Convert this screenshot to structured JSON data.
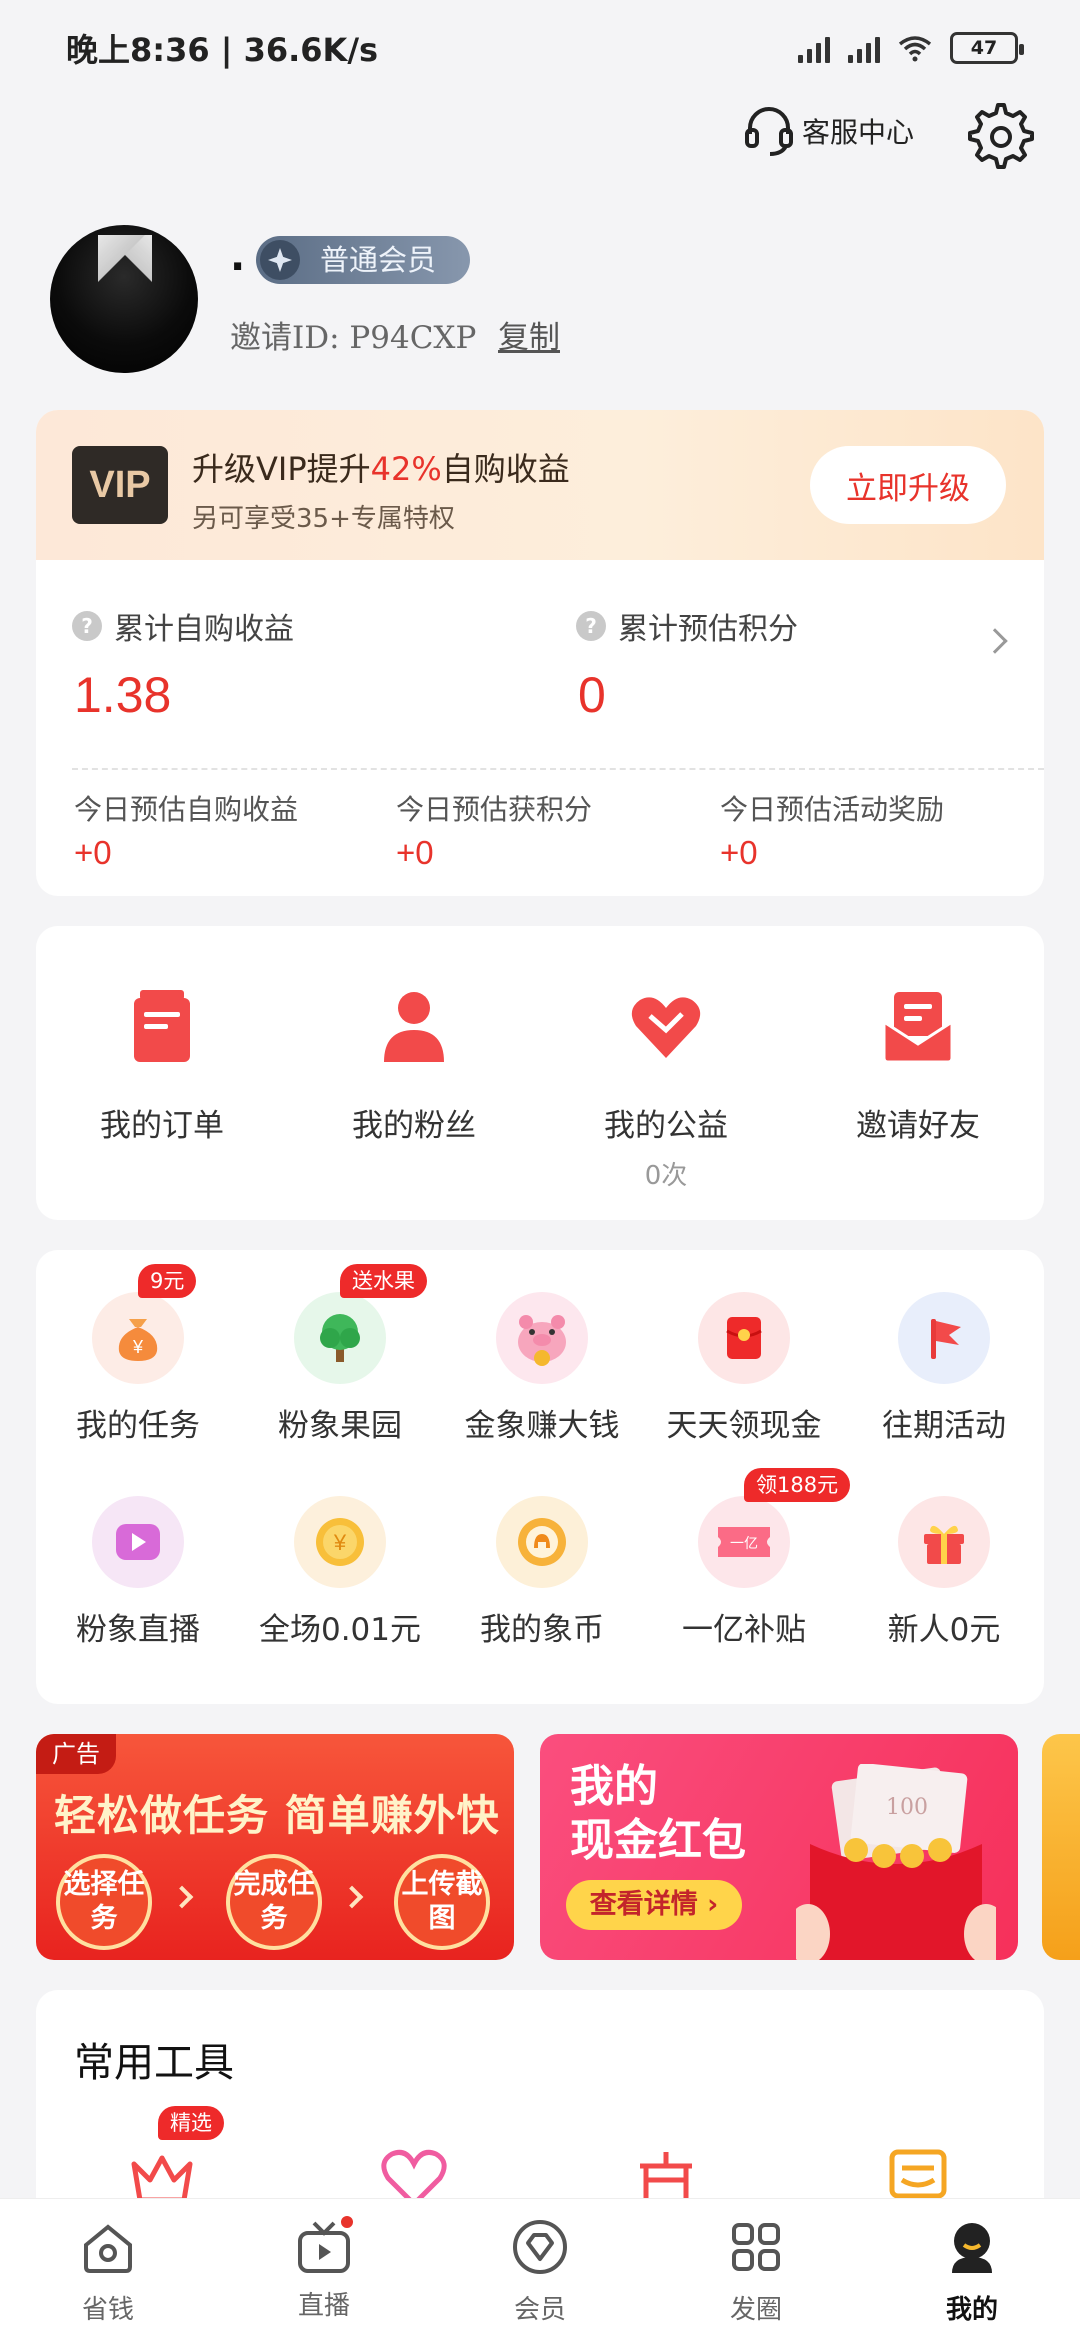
{
  "status_bar": {
    "time": "晚上8:36 | 36.6K/s",
    "battery": "47"
  },
  "header": {
    "service_label": "客服中心",
    "settings_icon": "gear-icon"
  },
  "profile": {
    "nickname": ".",
    "member_level": "普通会员",
    "invite_id": "邀请ID: P94CXP",
    "copy_label": "复制"
  },
  "vip_banner": {
    "logo": "VIP",
    "title_prefix": "升级VIP提升",
    "title_highlight": "42%",
    "title_suffix": "自购收益",
    "subtitle": "另可享受35+专属特权",
    "button": "立即升级"
  },
  "earnings": {
    "total_self_purchase_label": "累计自购收益",
    "total_self_purchase_value": "1.38",
    "total_points_label": "累计预估积分",
    "total_points_value": "0",
    "today": [
      {
        "label": "今日预估自购收益",
        "value": "+0"
      },
      {
        "label": "今日预估获积分",
        "value": "+0"
      },
      {
        "label": "今日预估活动奖励",
        "value": "+0"
      }
    ]
  },
  "quick_actions": [
    {
      "label": "我的订单",
      "icon": "order-icon"
    },
    {
      "label": "我的粉丝",
      "icon": "fans-icon"
    },
    {
      "label": "我的公益",
      "icon": "charity-heart-icon",
      "sub": "0次"
    },
    {
      "label": "邀请好友",
      "icon": "invite-mail-icon"
    }
  ],
  "features": [
    {
      "label": "我的任务",
      "icon": "money-bag-icon",
      "tag": "9元"
    },
    {
      "label": "粉象果园",
      "icon": "tree-icon",
      "tag": "送水果"
    },
    {
      "label": "金象赚大钱",
      "icon": "pig-icon"
    },
    {
      "label": "天天领现金",
      "icon": "red-packet-icon"
    },
    {
      "label": "往期活动",
      "icon": "flag-icon"
    },
    {
      "label": "粉象直播",
      "icon": "live-play-icon"
    },
    {
      "label": "全场0.01元",
      "icon": "yen-coin-icon"
    },
    {
      "label": "我的象币",
      "icon": "elephant-coin-icon"
    },
    {
      "label": "一亿补贴",
      "icon": "coupon-icon",
      "tag": "领188元",
      "icon_text": "一亿"
    },
    {
      "label": "新人0元",
      "icon": "gift-icon"
    }
  ],
  "banners": {
    "ad_tag": "广告",
    "task_title": "轻松做任务 简单赚外快",
    "steps": [
      "选择任务",
      "完成任务",
      "上传截图"
    ],
    "cash_title_line1": "我的",
    "cash_title_line2": "现金红包",
    "cash_button": "查看详情 ›",
    "note_value": "100"
  },
  "tools": {
    "title": "常用工具",
    "first_tag": "精选"
  },
  "tabbar": [
    {
      "label": "省钱",
      "icon": "home-icon"
    },
    {
      "label": "直播",
      "icon": "tv-icon"
    },
    {
      "label": "会员",
      "icon": "diamond-icon"
    },
    {
      "label": "发圈",
      "icon": "grid-icon"
    },
    {
      "label": "我的",
      "icon": "profile-icon",
      "active": true
    }
  ],
  "colors": {
    "accent": "#e8332b",
    "background": "#f4f4f6",
    "vip_dark": "#2f2a26"
  }
}
